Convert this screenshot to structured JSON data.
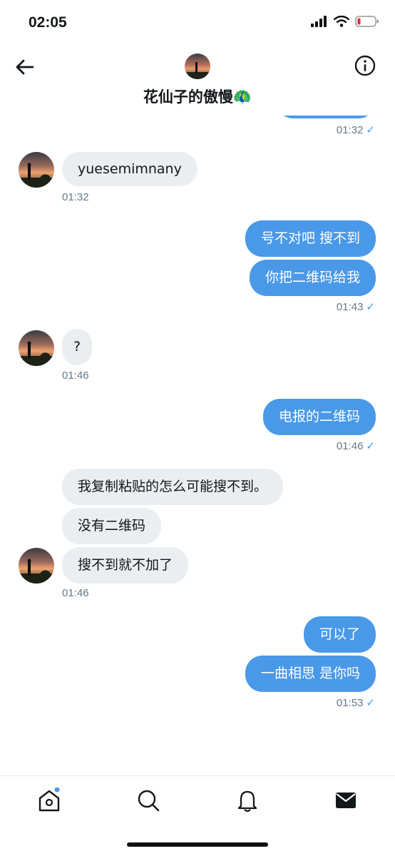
{
  "status": {
    "time": "02:05"
  },
  "header": {
    "name": "花仙子的傲慢🦚"
  },
  "messages": {
    "partial_time": "01:32",
    "m1": {
      "text": "yuesemimnany",
      "time": "01:32"
    },
    "m2": {
      "text": "号不对吧 搜不到"
    },
    "m3": {
      "text": "你把二维码给我",
      "time": "01:43"
    },
    "m4": {
      "text": "?",
      "time": "01:46"
    },
    "m5": {
      "text": "电报的二维码",
      "time": "01:46"
    },
    "m6": {
      "text": "我复制粘贴的怎么可能搜不到。"
    },
    "m7": {
      "text": "没有二维码"
    },
    "m8": {
      "text": "搜不到就不加了",
      "time": "01:46"
    },
    "m9": {
      "text": "可以了"
    },
    "m10": {
      "text": "一曲相思 是你吗",
      "time": "01:53"
    }
  },
  "tabs": [
    "home-icon",
    "search-icon",
    "notifications-icon",
    "messages-icon"
  ],
  "colors": {
    "accent": "#4a99e9",
    "incoming_bubble": "#ebeef0"
  }
}
